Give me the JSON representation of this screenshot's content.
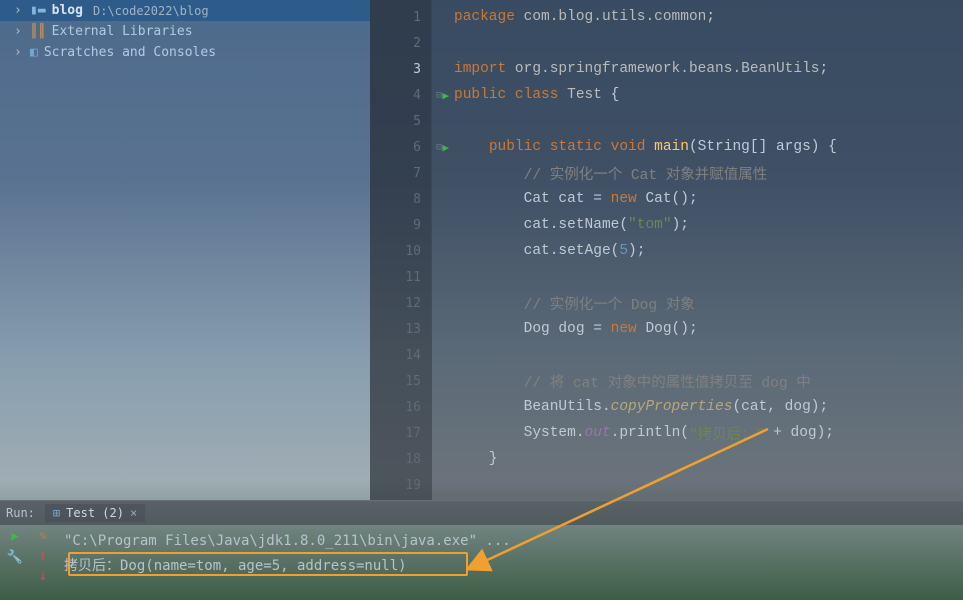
{
  "sidebar": {
    "items": [
      {
        "label": "blog",
        "path": "D:\\code2022\\blog",
        "icon": "folder",
        "selected": true
      },
      {
        "label": "External Libraries",
        "icon": "libraries"
      },
      {
        "label": "Scratches and Consoles",
        "icon": "scratches"
      }
    ]
  },
  "editor": {
    "current_line": 3,
    "run_marks": [
      4,
      6
    ],
    "fold_marks": [
      4,
      6,
      18
    ],
    "lines": [
      {
        "n": 1,
        "tokens": [
          {
            "t": "package ",
            "c": "kw"
          },
          {
            "t": "com.blog.utils.common",
            "c": "pkg"
          },
          {
            "t": ";",
            "c": "paren"
          }
        ]
      },
      {
        "n": 2,
        "tokens": []
      },
      {
        "n": 3,
        "tokens": [
          {
            "t": "import ",
            "c": "kw"
          },
          {
            "t": "org.springframework.beans.BeanUtils",
            "c": "pkg"
          },
          {
            "t": ";",
            "c": "paren"
          }
        ]
      },
      {
        "n": 4,
        "tokens": [
          {
            "t": "public class ",
            "c": "kw"
          },
          {
            "t": "Test ",
            "c": "clsname"
          },
          {
            "t": "{",
            "c": "paren"
          }
        ]
      },
      {
        "n": 5,
        "tokens": []
      },
      {
        "n": 6,
        "tokens": [
          {
            "t": "    ",
            "c": ""
          },
          {
            "t": "public static void ",
            "c": "kw"
          },
          {
            "t": "main",
            "c": "method-decl"
          },
          {
            "t": "(String[] args) {",
            "c": "paren"
          }
        ]
      },
      {
        "n": 7,
        "tokens": [
          {
            "t": "        ",
            "c": ""
          },
          {
            "t": "// 实例化一个 Cat 对象并赋值属性",
            "c": "comment"
          }
        ]
      },
      {
        "n": 8,
        "tokens": [
          {
            "t": "        ",
            "c": ""
          },
          {
            "t": "Cat cat = ",
            "c": "ident"
          },
          {
            "t": "new ",
            "c": "kw"
          },
          {
            "t": "Cat();",
            "c": "ident"
          }
        ]
      },
      {
        "n": 9,
        "tokens": [
          {
            "t": "        ",
            "c": ""
          },
          {
            "t": "cat.setName(",
            "c": "ident"
          },
          {
            "t": "\"tom\"",
            "c": "str"
          },
          {
            "t": ");",
            "c": "paren"
          }
        ]
      },
      {
        "n": 10,
        "tokens": [
          {
            "t": "        ",
            "c": ""
          },
          {
            "t": "cat.setAge(",
            "c": "ident"
          },
          {
            "t": "5",
            "c": "num"
          },
          {
            "t": ");",
            "c": "paren"
          }
        ]
      },
      {
        "n": 11,
        "tokens": []
      },
      {
        "n": 12,
        "tokens": [
          {
            "t": "        ",
            "c": ""
          },
          {
            "t": "// 实例化一个 Dog 对象",
            "c": "comment"
          }
        ]
      },
      {
        "n": 13,
        "tokens": [
          {
            "t": "        ",
            "c": ""
          },
          {
            "t": "Dog dog = ",
            "c": "ident"
          },
          {
            "t": "new ",
            "c": "kw"
          },
          {
            "t": "Dog();",
            "c": "ident"
          }
        ]
      },
      {
        "n": 14,
        "tokens": []
      },
      {
        "n": 15,
        "tokens": [
          {
            "t": "        ",
            "c": ""
          },
          {
            "t": "// 将 cat 对象中的属性值拷贝至 dog 中",
            "c": "comment"
          }
        ]
      },
      {
        "n": 16,
        "tokens": [
          {
            "t": "        ",
            "c": ""
          },
          {
            "t": "BeanUtils.",
            "c": "ident"
          },
          {
            "t": "copyProperties",
            "c": "static-method"
          },
          {
            "t": "(cat, dog);",
            "c": "paren"
          }
        ]
      },
      {
        "n": 17,
        "tokens": [
          {
            "t": "        ",
            "c": ""
          },
          {
            "t": "System.",
            "c": "ident"
          },
          {
            "t": "out",
            "c": "static-field"
          },
          {
            "t": ".println(",
            "c": "ident"
          },
          {
            "t": "\"拷贝后：\"",
            "c": "str"
          },
          {
            "t": " + dog);",
            "c": "ident"
          }
        ]
      },
      {
        "n": 18,
        "tokens": [
          {
            "t": "    }",
            "c": "paren"
          }
        ]
      },
      {
        "n": 19,
        "tokens": []
      }
    ]
  },
  "run_panel": {
    "title": "Run:",
    "tab_label": "Test (2)",
    "output": [
      "\"C:\\Program Files\\Java\\jdk1.8.0_211\\bin\\java.exe\" ...",
      "拷贝后：Dog(name=tom, age=5, address=null)"
    ]
  },
  "colors": {
    "accent": "#f0a030",
    "run_green": "#3fb54a"
  }
}
